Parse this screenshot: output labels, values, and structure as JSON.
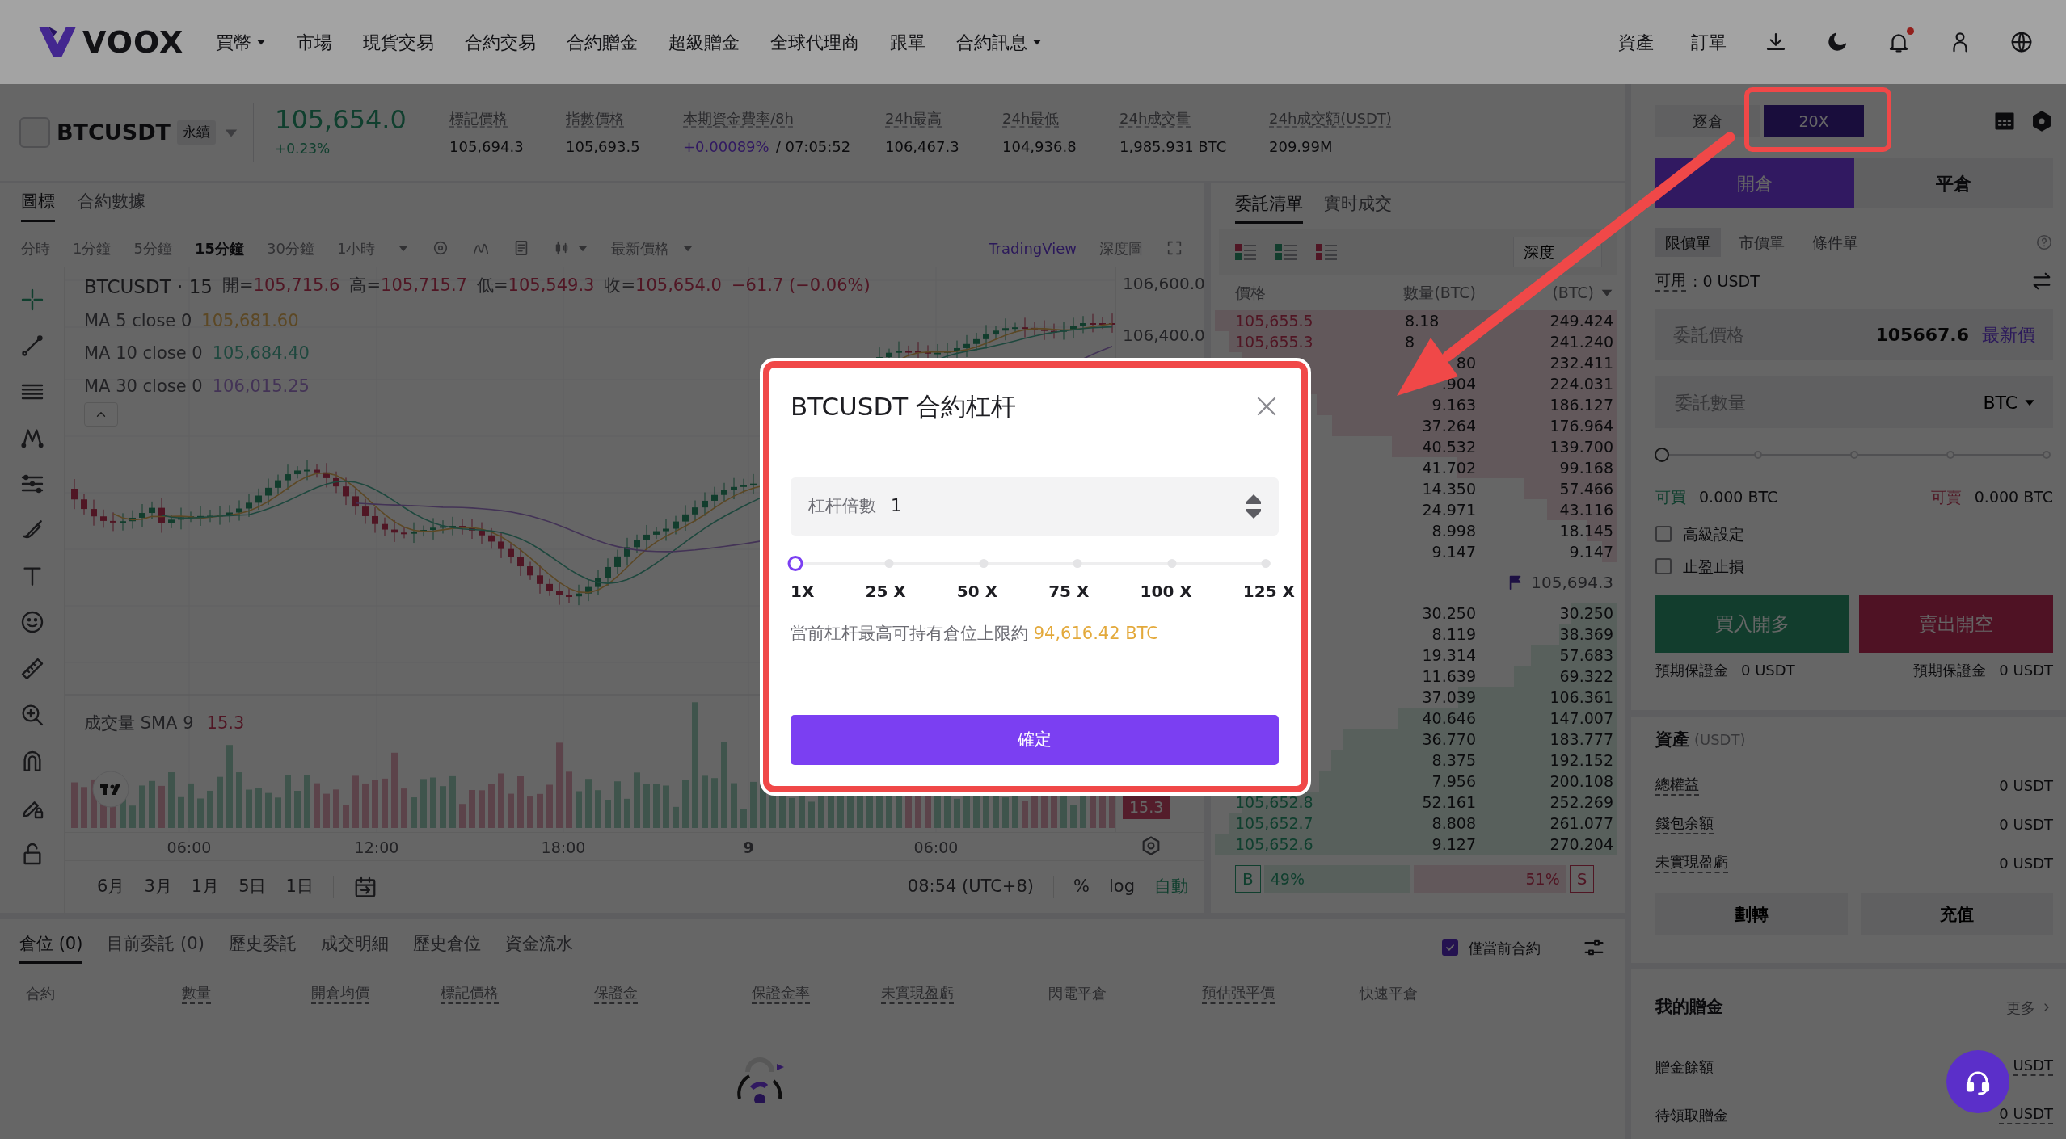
{
  "nav": {
    "logo": "VOOX",
    "items": [
      {
        "label": "買幣",
        "dropdown": true
      },
      {
        "label": "市場",
        "dropdown": false
      },
      {
        "label": "現貨交易",
        "dropdown": false
      },
      {
        "label": "合約交易",
        "dropdown": false
      },
      {
        "label": "合約贈金",
        "dropdown": false
      },
      {
        "label": "超級贈金",
        "dropdown": false
      },
      {
        "label": "全球代理商",
        "dropdown": false
      },
      {
        "label": "跟單",
        "dropdown": false
      },
      {
        "label": "合約訊息",
        "dropdown": true
      }
    ],
    "links": [
      "資產",
      "訂單"
    ],
    "notification": true
  },
  "ticker": {
    "symbol": "BTCUSDT",
    "badge": "永續",
    "price": "105,654.0",
    "change": "+0.23%",
    "stats": [
      {
        "label": "標記價格",
        "value": "105,694.3",
        "highlight": false
      },
      {
        "label": "指數價格",
        "value": "105,693.5",
        "highlight": false
      },
      {
        "label": "本期資金費率/8h",
        "value": "+0.00089%",
        "suffix": "/ 07:05:52",
        "highlight": true
      },
      {
        "label": "24h最高",
        "value": "106,467.3",
        "highlight": false
      },
      {
        "label": "24h最低",
        "value": "104,936.8",
        "highlight": false
      },
      {
        "label": "24h成交量",
        "value": "1,985.931 BTC",
        "highlight": false
      },
      {
        "label": "24h成交額(USDT)",
        "value": "209.99M",
        "highlight": false
      }
    ]
  },
  "chart": {
    "tabs": [
      {
        "label": "圖標",
        "selected": true
      },
      {
        "label": "合約數據",
        "selected": false
      }
    ],
    "intervals": [
      {
        "label": "分時",
        "selected": false
      },
      {
        "label": "1分鐘",
        "selected": false
      },
      {
        "label": "5分鐘",
        "selected": false
      },
      {
        "label": "15分鐘",
        "selected": true
      },
      {
        "label": "30分鐘",
        "selected": false
      },
      {
        "label": "1小時",
        "selected": false
      }
    ],
    "price_type": "最新價格",
    "tradingview": "TradingView",
    "depth_chart": "深度圖",
    "legend_title": "BTCUSDT · 15",
    "ohlc": [
      {
        "label": "開=",
        "value": "105,715.6"
      },
      {
        "label": "高=",
        "value": "105,715.7"
      },
      {
        "label": "低=",
        "value": "105,549.3"
      },
      {
        "label": "收=",
        "value": "105,654.0"
      }
    ],
    "change": "−61.7 (−0.06%)",
    "ma": [
      {
        "label": "MA 5 close 0",
        "value": "105,681.60"
      },
      {
        "label": "MA 10 close 0",
        "value": "105,684.40"
      },
      {
        "label": "MA 30 close 0",
        "value": "106,015.25"
      }
    ],
    "volume_label": "成交量 SMA 9",
    "volume_value": "15.3",
    "volume_badge": "15.3",
    "price_ticks": [
      "106,600.0",
      "106,400.0"
    ],
    "time_ticks": [
      "06:00",
      "12:00",
      "18:00",
      "9",
      "06:00"
    ],
    "ranges": [
      "6月",
      "3月",
      "1月",
      "5日",
      "1日"
    ],
    "clock": "08:54 (UTC+8)",
    "scale_options": [
      {
        "label": "%",
        "selected": false
      },
      {
        "label": "log",
        "selected": false
      },
      {
        "label": "自動",
        "selected": true
      }
    ]
  },
  "order_book": {
    "tabs": [
      {
        "label": "委託清單",
        "selected": true
      },
      {
        "label": "實时成交",
        "selected": false
      }
    ],
    "depth_select": "深度",
    "columns": [
      "價格",
      "數量(BTC)",
      "(BTC)"
    ],
    "asks": [
      {
        "price": "105,655.5",
        "quantity": "8.18",
        "total": "249.424"
      },
      {
        "price": "105,655.3",
        "quantity": "8",
        "total": "241.240"
      },
      {
        "quantity": "80",
        "total": "232.411"
      },
      {
        "quantity": ".904",
        "total": "224.031"
      },
      {
        "quantity": "9.163",
        "total": "186.127"
      },
      {
        "quantity": "37.264",
        "total": "176.964"
      },
      {
        "quantity": "40.532",
        "total": "139.700"
      },
      {
        "quantity": "41.702",
        "total": "99.168"
      },
      {
        "quantity": "14.350",
        "total": "57.466"
      },
      {
        "quantity": "24.971",
        "total": "43.116"
      },
      {
        "quantity": "8.998",
        "total": "18.145"
      },
      {
        "quantity": "9.147",
        "total": "9.147"
      }
    ],
    "last_price": "105,694.3",
    "bids": [
      {
        "quantity": "30.250",
        "total": "30.250"
      },
      {
        "quantity": "8.119",
        "total": "38.369"
      },
      {
        "quantity": "19.314",
        "total": "57.683"
      },
      {
        "quantity": "11.639",
        "total": "69.322"
      },
      {
        "quantity": "37.039",
        "total": "106.361"
      },
      {
        "quantity": "40.646",
        "total": "147.007"
      },
      {
        "quantity": "36.770",
        "total": "183.777"
      },
      {
        "quantity": "8.375",
        "total": "192.152"
      },
      {
        "quantity": "7.956",
        "total": "200.108"
      },
      {
        "price": "105,652.8",
        "quantity": "52.161",
        "total": "252.269"
      },
      {
        "price": "105,652.7",
        "quantity": "8.808",
        "total": "261.077"
      },
      {
        "price": "105,652.6",
        "quantity": "9.127",
        "total": "270.204"
      }
    ],
    "buy_label": "B",
    "buy_share": "49%",
    "sell_share": "51%",
    "sell_label": "S"
  },
  "trade": {
    "margin_mode": "逐倉",
    "leverage": "20X",
    "tabs": [
      {
        "label": "開倉",
        "selected": true
      },
      {
        "label": "平倉",
        "selected": false
      }
    ],
    "order_types": [
      {
        "label": "限價單",
        "selected": true
      },
      {
        "label": "市價單",
        "selected": false
      },
      {
        "label": "條件單",
        "selected": false
      }
    ],
    "available_label": "可用",
    "available_value": ": 0 USDT",
    "price_field": {
      "label": "委託價格",
      "value": "105667.6",
      "action": "最新價"
    },
    "amount_field": {
      "placeholder": "委託數量",
      "unit": "BTC"
    },
    "slider": {
      "level": 0
    },
    "can_buy": {
      "label": "可買",
      "value": "0.000 BTC"
    },
    "can_sell": {
      "label": "可賣",
      "value": "0.000 BTC"
    },
    "options": [
      {
        "label": "高級設定",
        "checked": false
      },
      {
        "label": "止盈止損",
        "checked": false
      }
    ],
    "buy_button": "買入開多",
    "sell_button": "賣出開空",
    "margins": [
      {
        "label": "預期保證金",
        "value": "0 USDT"
      },
      {
        "label": "預期保證金",
        "value": "0 USDT"
      }
    ],
    "assets_title": "資產",
    "assets_unit": "(USDT)",
    "assets": [
      {
        "label": "總權益",
        "value": "0 USDT"
      },
      {
        "label": "錢包余額",
        "value": "0 USDT"
      },
      {
        "label": "未實現盈虧",
        "value": "0 USDT"
      }
    ],
    "asset_buttons": [
      "劃轉",
      "充值"
    ],
    "bonus_title": "我的贈金",
    "bonus_more": "更多",
    "bonus": [
      {
        "label": "贈金餘額",
        "value": "USDT"
      },
      {
        "label": "待領取贈金",
        "value": "0 USDT"
      }
    ]
  },
  "positions": {
    "tabs": [
      {
        "label": "倉位 (0)",
        "selected": true
      },
      {
        "label": "目前委託 (0)",
        "selected": false
      },
      {
        "label": "歷史委託",
        "selected": false
      },
      {
        "label": "成交明細",
        "selected": false
      },
      {
        "label": "歷史倉位",
        "selected": false
      },
      {
        "label": "資金流水",
        "selected": false
      }
    ],
    "filter": {
      "label": "僅當前合約",
      "checked": true
    },
    "columns": [
      {
        "label": "合約",
        "tooltip": false
      },
      {
        "label": "數量",
        "tooltip": true
      },
      {
        "label": "開倉均價",
        "tooltip": true
      },
      {
        "label": "標記價格",
        "tooltip": true
      },
      {
        "label": "保證金",
        "tooltip": true
      },
      {
        "label": "保證金率",
        "tooltip": true
      },
      {
        "label": "未實現盈虧",
        "tooltip": true
      },
      {
        "label": "閃電平倉",
        "tooltip": false
      },
      {
        "label": "預估强平價",
        "tooltip": true
      },
      {
        "label": "快速平倉",
        "tooltip": false
      }
    ]
  },
  "dialog": {
    "title": "BTCUSDT 合約杠杆",
    "field_label": "杠杆倍數",
    "value": "1",
    "level": 0,
    "marks": [
      "1X",
      "25 X",
      "50 X",
      "75 X",
      "100 X",
      "125 X"
    ],
    "limit_text": "當前杠杆最高可持有倉位上限約",
    "limit_value": "94,616.42 BTC",
    "confirm": "確定"
  }
}
